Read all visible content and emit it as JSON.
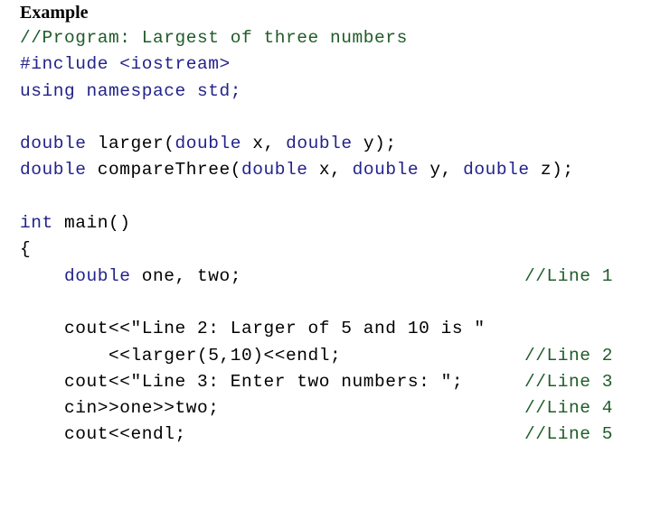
{
  "slide": {
    "title": "Example",
    "colors": {
      "background": "#ffffff",
      "keyword": "#22228c",
      "identifier": "#000000",
      "comment": "#1f5c28",
      "title": "#000000"
    }
  },
  "code": {
    "lines": [
      {
        "id": "line-comment-program",
        "kind": "comment",
        "text": "//Program: Largest of three numbers",
        "trailing_comment": ""
      },
      {
        "id": "line-include",
        "kind": "preprocessor",
        "keyword": "#include <iostream>",
        "rest": "",
        "text": "#include <iostream>",
        "trailing_comment": ""
      },
      {
        "id": "line-using",
        "kind": "code",
        "keyword": "using namespace std;",
        "rest": "",
        "text": "using namespace std;",
        "trailing_comment": ""
      },
      {
        "id": "line-blank-1",
        "kind": "blank",
        "text": "",
        "trailing_comment": ""
      },
      {
        "id": "line-proto-larger",
        "kind": "code",
        "keyword": "double",
        "rest": " larger(",
        "keyword2": "double",
        "rest2": " x, ",
        "keyword3": "double",
        "rest3": " y);",
        "text": "double larger(double x, double y);",
        "trailing_comment": ""
      },
      {
        "id": "line-proto-comparethree",
        "kind": "code",
        "keyword": "double",
        "rest": " compareThree(",
        "keyword2": "double",
        "rest2": " x, ",
        "keyword3": "double",
        "rest3": " y, ",
        "keyword4": "double",
        "rest4": " z);",
        "text": "double compareThree(double x, double y, double z);",
        "trailing_comment": ""
      },
      {
        "id": "line-blank-2",
        "kind": "blank",
        "text": "",
        "trailing_comment": ""
      },
      {
        "id": "line-main",
        "kind": "code",
        "keyword": "int",
        "rest": " main()",
        "text": "int main()",
        "trailing_comment": ""
      },
      {
        "id": "line-open-brace",
        "kind": "code",
        "keyword": "",
        "rest": "{",
        "text": "{",
        "trailing_comment": ""
      },
      {
        "id": "line-decl-one-two",
        "kind": "code",
        "indent": "    ",
        "keyword": "double",
        "rest": " one, two;",
        "text": "    double one, two;",
        "trailing_comment": "//Line 1"
      },
      {
        "id": "line-blank-3",
        "kind": "blank",
        "text": "",
        "trailing_comment": ""
      },
      {
        "id": "line-cout-line2",
        "kind": "code",
        "indent": "    ",
        "keyword": "",
        "rest": "cout<<\"Line 2: Larger of 5 and 10 is \"",
        "text": "    cout<<\"Line 2: Larger of 5 and 10 is \"",
        "trailing_comment": ""
      },
      {
        "id": "line-cout-larger-call",
        "kind": "code",
        "indent": "        ",
        "keyword": "",
        "rest": "<<larger(5,10)<<endl;",
        "text": "        <<larger(5,10)<<endl;",
        "trailing_comment": "//Line 2"
      },
      {
        "id": "line-cout-line3",
        "kind": "code",
        "indent": "    ",
        "keyword": "",
        "rest": "cout<<\"Line 3: Enter two numbers: \";",
        "text": "    cout<<\"Line 3: Enter two numbers: \";",
        "trailing_comment": "//Line 3"
      },
      {
        "id": "line-cin",
        "kind": "code",
        "indent": "    ",
        "keyword": "",
        "rest": "cin>>one>>two;",
        "text": "    cin>>one>>two;",
        "trailing_comment": "//Line 4"
      },
      {
        "id": "line-cout-endl",
        "kind": "code",
        "indent": "    ",
        "keyword": "",
        "rest": "cout<<endl;",
        "text": "    cout<<endl;",
        "trailing_comment": "//Line 5"
      }
    ]
  }
}
